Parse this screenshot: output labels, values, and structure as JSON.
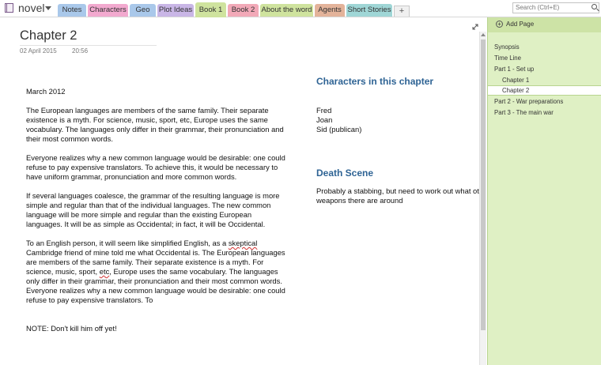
{
  "notebook": {
    "title": "novel"
  },
  "tabs": [
    {
      "label": "Notes",
      "color": "#a9c8ea"
    },
    {
      "label": "Characters",
      "color": "#f2a9cf"
    },
    {
      "label": "Geo",
      "color": "#a9c8ea"
    },
    {
      "label": "Plot Ideas",
      "color": "#c9b6e6"
    },
    {
      "label": "Book 1",
      "color": "#cfe39e",
      "active": true
    },
    {
      "label": "Book 2",
      "color": "#f2a9b8"
    },
    {
      "label": "About the word",
      "color": "#cfe39e"
    },
    {
      "label": "Agents",
      "color": "#e3b39a"
    },
    {
      "label": "Short Stories",
      "color": "#9fd6d6"
    }
  ],
  "tab_add_label": "+",
  "search": {
    "placeholder": "Search (Ctrl+E)"
  },
  "page": {
    "title": "Chapter 2",
    "date": "02 April 2015",
    "time": "20:56",
    "body": {
      "month": "March 2012",
      "p1": "The European languages are members of the same family. Their separate existence is a myth. For science, music, sport, etc, Europe uses the same vocabulary. The languages only differ in their grammar, their pronunciation and their most common words.",
      "p2": "Everyone realizes why a new common language would be desirable: one could refuse to pay expensive translators. To achieve this, it would be necessary to have uniform grammar, pronunciation and more common words.",
      "p3": "If several languages coalesce, the grammar of the resulting language is more simple and regular than that of the individual languages. The new common language will be more simple and regular than the existing European languages. It will be as simple as Occidental; in fact, it will be Occidental.",
      "p4a": "To an English person, it will seem like simplified English, as a ",
      "p4_sq1": "skeptical",
      "p4b": " Cambridge friend of mine told me what Occidental is. The European languages are members of the same family. Their separate existence is a myth. For science, music, sport, ",
      "p4_sq2": "etc",
      "p4c": ", Europe uses the same vocabulary. The languages only differ in their grammar, their pronunciation and their most common words. Everyone realizes why a new common language would be desirable: one could refuse to pay expensive translators. To",
      "note": "NOTE: Don't kill him off yet!"
    },
    "side": {
      "characters_heading": "Characters in this chapter",
      "characters": [
        "Fred",
        "Joan",
        "Sid (publican)"
      ],
      "death_heading": "Death Scene",
      "death_text_1": "Probably a stabbing, but need to work out what ot",
      "death_text_2": "weapons there are around"
    }
  },
  "pane": {
    "add_page_label": "Add Page",
    "items": [
      {
        "label": "Synopsis",
        "level": 0
      },
      {
        "label": "Time Line",
        "level": 0
      },
      {
        "label": "Part 1 - Set up",
        "level": 0
      },
      {
        "label": "Chapter 1",
        "level": 1
      },
      {
        "label": "Chapter 2",
        "level": 1,
        "selected": true
      },
      {
        "label": "Part 2 - War preparations",
        "level": 0
      },
      {
        "label": "Part 3 - The main war",
        "level": 0
      }
    ]
  }
}
